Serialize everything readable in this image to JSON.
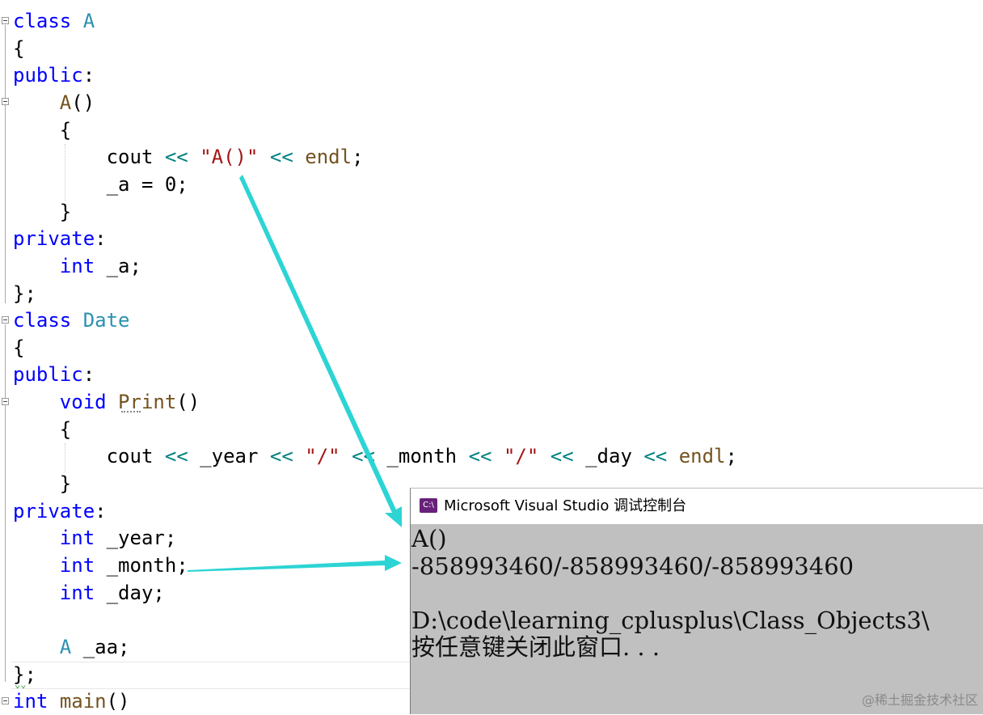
{
  "editor": {
    "lines": [
      {
        "t": [
          [
            "kw",
            "class"
          ],
          [
            "id",
            " "
          ],
          [
            "ty",
            "A"
          ]
        ]
      },
      {
        "t": [
          [
            "id",
            "{"
          ]
        ]
      },
      {
        "t": [
          [
            "kw",
            "public"
          ],
          [
            "id",
            ":"
          ]
        ]
      },
      {
        "t": [
          [
            "id",
            "    "
          ],
          [
            "fn",
            "A"
          ],
          [
            "id",
            "()"
          ]
        ]
      },
      {
        "t": [
          [
            "id",
            "    {"
          ]
        ]
      },
      {
        "t": [
          [
            "id",
            "        cout "
          ],
          [
            "op",
            "<<"
          ],
          [
            "id",
            " "
          ],
          [
            "str",
            "\"A()\""
          ],
          [
            "id",
            " "
          ],
          [
            "op",
            "<<"
          ],
          [
            "id",
            " "
          ],
          [
            "fn",
            "endl"
          ],
          [
            "id",
            ";"
          ]
        ]
      },
      {
        "t": [
          [
            "id",
            "        _a = 0;"
          ]
        ]
      },
      {
        "t": [
          [
            "id",
            "    }"
          ]
        ]
      },
      {
        "t": [
          [
            "kw",
            "private"
          ],
          [
            "id",
            ":"
          ]
        ]
      },
      {
        "t": [
          [
            "id",
            "    "
          ],
          [
            "kw",
            "int"
          ],
          [
            "id",
            " _a;"
          ]
        ]
      },
      {
        "t": [
          [
            "id",
            "};"
          ]
        ]
      },
      {
        "t": [
          [
            "kw",
            "class"
          ],
          [
            "id",
            " "
          ],
          [
            "ty",
            "Date"
          ]
        ]
      },
      {
        "t": [
          [
            "id",
            "{"
          ]
        ]
      },
      {
        "t": [
          [
            "kw",
            "public"
          ],
          [
            "id",
            ":"
          ]
        ]
      },
      {
        "t": [
          [
            "id",
            "    "
          ],
          [
            "kw",
            "void"
          ],
          [
            "id",
            " "
          ],
          [
            "fn",
            "Print"
          ],
          [
            "id",
            "()"
          ]
        ]
      },
      {
        "t": [
          [
            "id",
            "    {"
          ]
        ]
      },
      {
        "t": [
          [
            "id",
            "        cout "
          ],
          [
            "op",
            "<<"
          ],
          [
            "id",
            " _year "
          ],
          [
            "op",
            "<<"
          ],
          [
            "id",
            " "
          ],
          [
            "str",
            "\"/\""
          ],
          [
            "id",
            " "
          ],
          [
            "op",
            "<<"
          ],
          [
            "id",
            " _month "
          ],
          [
            "op",
            "<<"
          ],
          [
            "id",
            " "
          ],
          [
            "str",
            "\"/\""
          ],
          [
            "id",
            " "
          ],
          [
            "op",
            "<<"
          ],
          [
            "id",
            " _day "
          ],
          [
            "op",
            "<<"
          ],
          [
            "id",
            " "
          ],
          [
            "fn",
            "endl"
          ],
          [
            "id",
            ";"
          ]
        ]
      },
      {
        "t": [
          [
            "id",
            "    }"
          ]
        ]
      },
      {
        "t": [
          [
            "kw",
            "private"
          ],
          [
            "id",
            ":"
          ]
        ]
      },
      {
        "t": [
          [
            "id",
            "    "
          ],
          [
            "kw",
            "int"
          ],
          [
            "id",
            " _year;"
          ]
        ]
      },
      {
        "t": [
          [
            "id",
            "    "
          ],
          [
            "kw",
            "int"
          ],
          [
            "id",
            " _month;"
          ]
        ]
      },
      {
        "t": [
          [
            "id",
            "    "
          ],
          [
            "kw",
            "int"
          ],
          [
            "id",
            " _day;"
          ]
        ]
      },
      {
        "t": [
          [
            "id",
            ""
          ]
        ]
      },
      {
        "t": [
          [
            "id",
            "    "
          ],
          [
            "ty",
            "A"
          ],
          [
            "id",
            " _aa;"
          ]
        ]
      },
      {
        "t": [
          [
            "id",
            "};"
          ]
        ]
      },
      {
        "t": [
          [
            "kw",
            "int"
          ],
          [
            "id",
            " "
          ],
          [
            "fn",
            "main"
          ],
          [
            "id",
            "()"
          ]
        ]
      }
    ]
  },
  "console": {
    "icon_label": "C:\\",
    "title": "Microsoft Visual Studio 调试控制台",
    "output": [
      "A()",
      "-858993460/-858993460/-858993460",
      "",
      "D:\\code\\learning_cplusplus\\Class_Objects3\\",
      "按任意键关闭此窗口. . ."
    ]
  },
  "watermark": "@稀土掘金技术社区",
  "colors": {
    "keyword": "#0000ff",
    "type": "#2b91af",
    "function": "#74531f",
    "string": "#a31515",
    "operator": "#008080",
    "console_bg": "#c0c0c0",
    "arrow": "#2dd4d4"
  }
}
